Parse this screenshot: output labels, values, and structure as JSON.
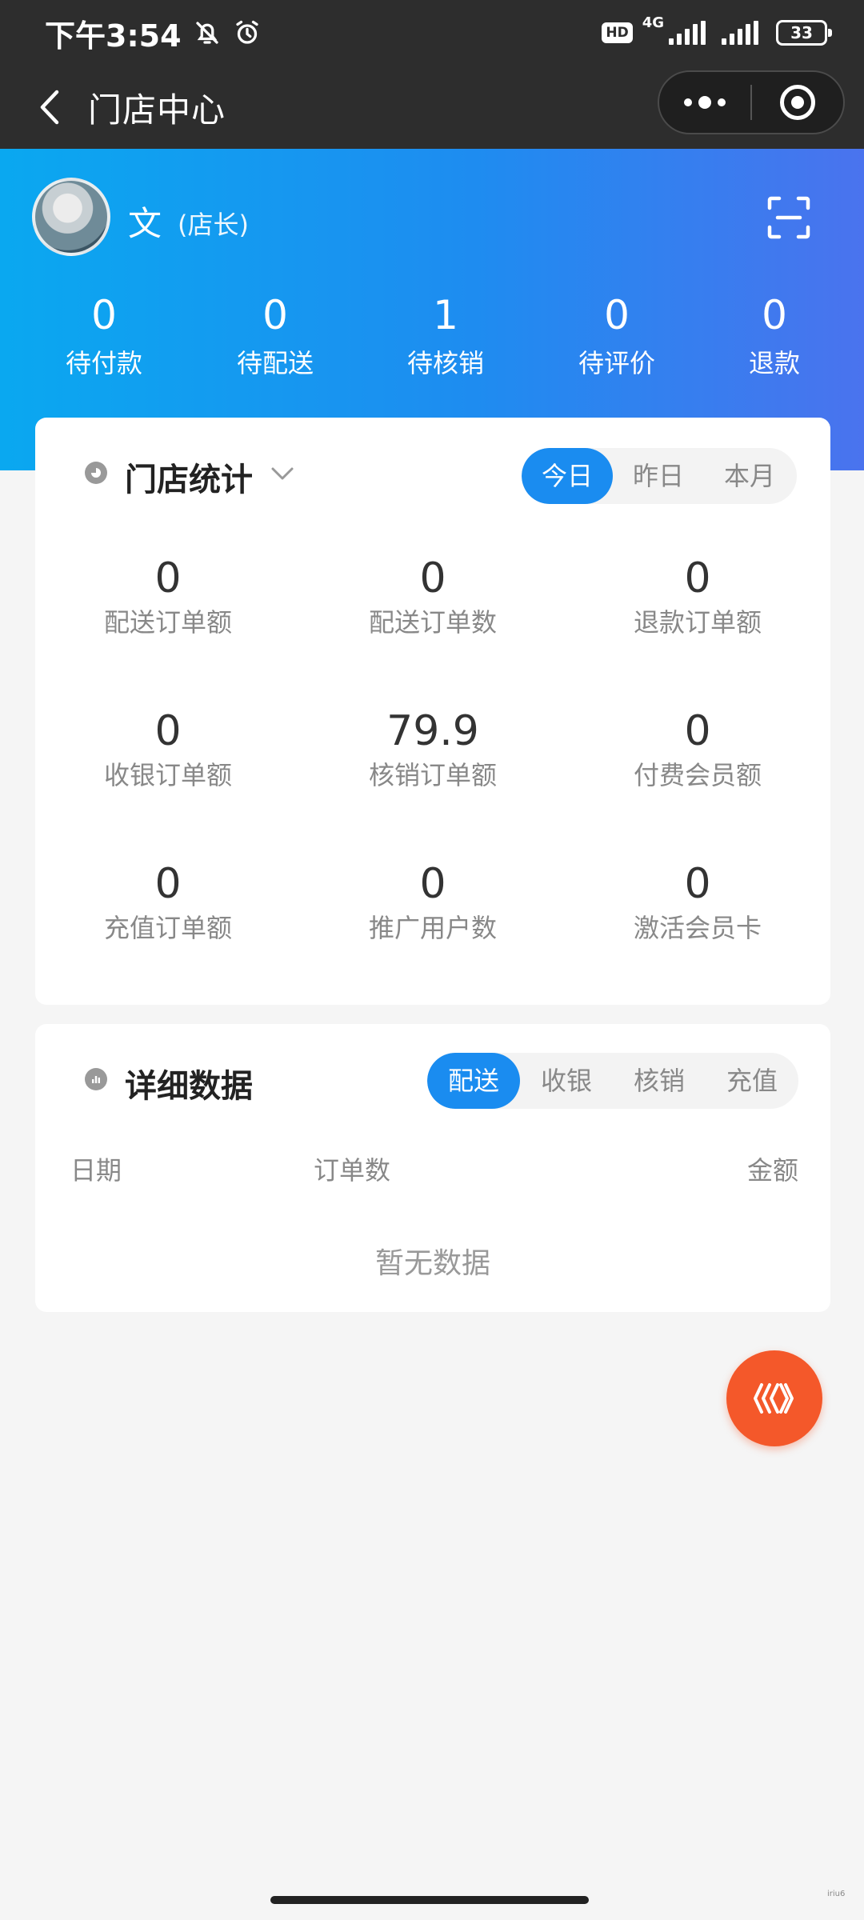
{
  "status_bar": {
    "time": "下午3:54",
    "hd": "HD",
    "network": "4G",
    "battery": "33"
  },
  "nav": {
    "title": "门店中心",
    "more_icon": "more-dots-icon",
    "close_icon": "target-circle-icon"
  },
  "user": {
    "name": "文",
    "role": "(店长)"
  },
  "order_stats": [
    {
      "value": "0",
      "label": "待付款"
    },
    {
      "value": "0",
      "label": "待配送"
    },
    {
      "value": "1",
      "label": "待核销"
    },
    {
      "value": "0",
      "label": "待评价"
    },
    {
      "value": "0",
      "label": "退款"
    }
  ],
  "store_stats": {
    "title": "门店统计",
    "tabs": [
      "今日",
      "昨日",
      "本月"
    ],
    "active_tab": "今日",
    "items": [
      {
        "value": "0",
        "label": "配送订单额"
      },
      {
        "value": "0",
        "label": "配送订单数"
      },
      {
        "value": "0",
        "label": "退款订单额"
      },
      {
        "value": "0",
        "label": "收银订单额"
      },
      {
        "value": "79.9",
        "label": "核销订单额"
      },
      {
        "value": "0",
        "label": "付费会员额"
      },
      {
        "value": "0",
        "label": "充值订单额"
      },
      {
        "value": "0",
        "label": "推广用户数"
      },
      {
        "value": "0",
        "label": "激活会员卡"
      }
    ]
  },
  "detail": {
    "title": "详细数据",
    "tabs": [
      "配送",
      "收银",
      "核销",
      "充值"
    ],
    "active_tab": "配送",
    "columns": [
      "日期",
      "订单数",
      "金额"
    ],
    "empty_text": "暂无数据"
  },
  "colors": {
    "accent": "#1a8cf0",
    "header_gradient_start": "#0aa8f0",
    "header_gradient_end": "#4a73ee",
    "fab": "#f4582a"
  },
  "watermark": "iriu6"
}
